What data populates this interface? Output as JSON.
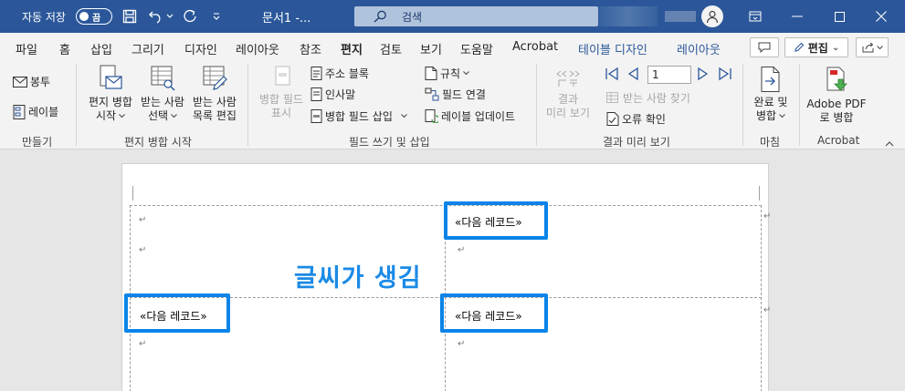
{
  "titlebar": {
    "autosave_label": "자동 저장",
    "autosave_toggle": "끔",
    "doc_title": "문서1  -...",
    "search_placeholder": "검색"
  },
  "menu": {
    "tabs": [
      "파일",
      "홈",
      "삽입",
      "그리기",
      "디자인",
      "레이아웃",
      "참조",
      "편지",
      "검토",
      "보기",
      "도움말",
      "Acrobat"
    ],
    "active_tab": "편지",
    "context_tabs": [
      "테이블 디자인",
      "레이아웃"
    ],
    "edit_button": "편집",
    "edit_chevron": "⌄"
  },
  "ribbon": {
    "create": {
      "envelope": "봉투",
      "labels": "레이블",
      "group": "만들기"
    },
    "start_merge": {
      "start_l1": "편지 병합",
      "start_l2": "시작",
      "select_l1": "받는 사람",
      "select_l2": "선택",
      "edit_l1": "받는 사람",
      "edit_l2": "목록 편집",
      "group": "편지 병합 시작"
    },
    "write_insert": {
      "highlight_l1": "병합 필드",
      "highlight_l2": "표시",
      "address_block": "주소 블록",
      "greeting": "인사말",
      "insert_merge_field": "병합 필드 삽입",
      "rules": "규칙",
      "match_fields": "필드 연결",
      "update_labels": "레이블 업데이트",
      "group": "필드 쓰기 및 삽입"
    },
    "preview": {
      "preview_l1": "결과",
      "preview_l2": "미리 보기",
      "record_number": "1",
      "find_recipient": "받는 사람 찾기",
      "check_errors": "오류 확인",
      "group": "결과 미리 보기"
    },
    "finish": {
      "finish_l1": "완료 및",
      "finish_l2": "병합",
      "group": "마침"
    },
    "acrobat": {
      "create_l1": "Adobe PDF",
      "create_l2": "로 병합",
      "group": "Acrobat"
    }
  },
  "document": {
    "next_record_field": "«다음 레코드»",
    "annotation": "글씨가 생김",
    "para_mark": "↵"
  },
  "colors": {
    "titlebar": "#2b579a",
    "highlight_box": "#0a84e8",
    "annotation": "#1a8ae6"
  }
}
